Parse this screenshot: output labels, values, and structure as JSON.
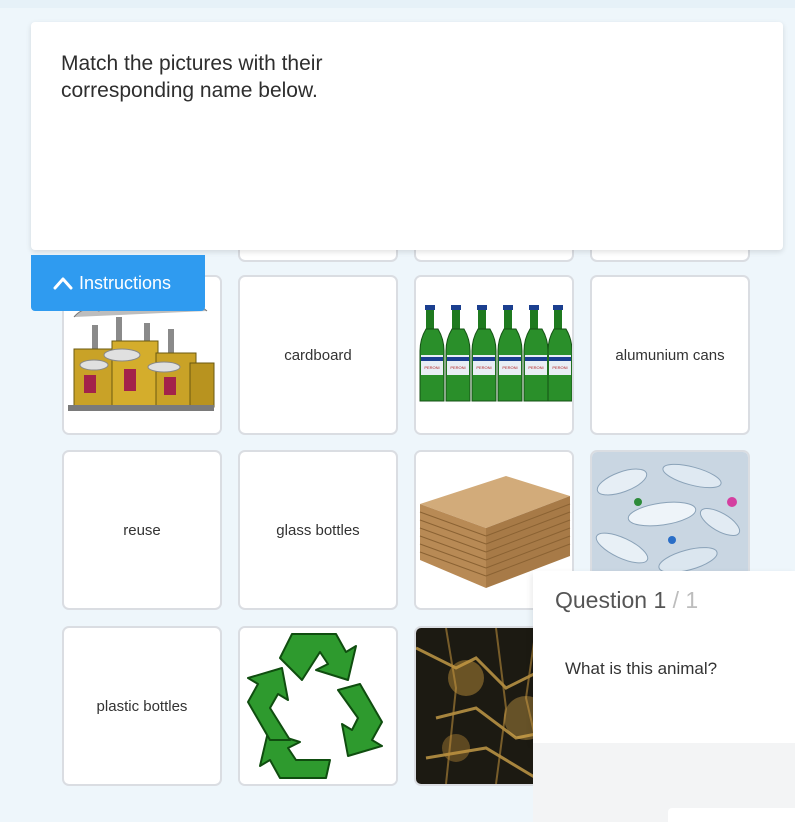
{
  "instruction": {
    "text": "Match the pictures with their corresponding name below."
  },
  "instructions_tab": {
    "label": "Instructions",
    "icon": "chevron-up-icon"
  },
  "tiles": {
    "cardboard": "cardboard",
    "alumunium_cans": "alumunium cans",
    "reuse": "reuse",
    "glass_bottles": "glass bottles",
    "plastic_bottles": "plastic bottles"
  },
  "bottle_brand": "PERONI",
  "question": {
    "label": "Question",
    "current": "1",
    "separator": "/",
    "total": "1",
    "text": "What is this animal?"
  },
  "colors": {
    "accent": "#2f9bf0",
    "recycle_green": "#2e9a2e",
    "tile_border": "#dadde2"
  }
}
